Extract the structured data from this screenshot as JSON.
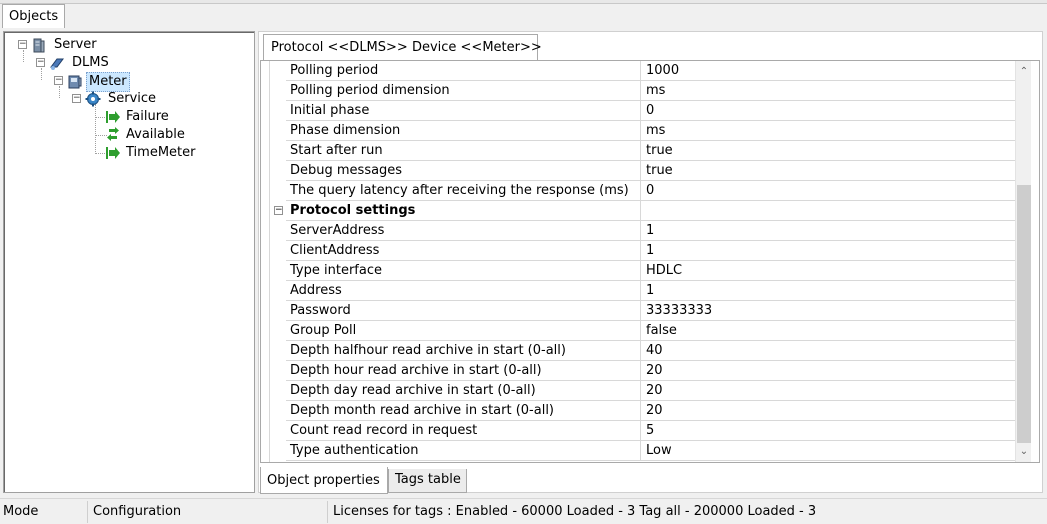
{
  "left_tab": {
    "label": "Objects"
  },
  "tree": {
    "server": "Server",
    "dlms": "DLMS",
    "meter": "Meter",
    "service": "Service",
    "failure": "Failure",
    "available": "Available",
    "timemeter": "TimeMeter"
  },
  "protocol_tab": {
    "label": "Protocol <<DLMS>> Device <<Meter>>"
  },
  "properties": [
    {
      "name": "Polling period",
      "value": "1000"
    },
    {
      "name": "Polling period dimension",
      "value": "ms"
    },
    {
      "name": "Initial phase",
      "value": "0"
    },
    {
      "name": "Phase dimension",
      "value": "ms"
    },
    {
      "name": "Start after run",
      "value": "true"
    },
    {
      "name": "Debug messages",
      "value": "true"
    },
    {
      "name": "The query latency after receiving the response (ms)",
      "value": "0"
    },
    {
      "name": "Protocol settings",
      "value": "",
      "category": true
    },
    {
      "name": "ServerAddress",
      "value": "1"
    },
    {
      "name": "ClientAddress",
      "value": "1"
    },
    {
      "name": "Type interface",
      "value": "HDLC"
    },
    {
      "name": "Address",
      "value": "1"
    },
    {
      "name": "Password",
      "value": "33333333"
    },
    {
      "name": "Group Poll",
      "value": "false"
    },
    {
      "name": "Depth halfhour read archive in start (0-all)",
      "value": "40"
    },
    {
      "name": "Depth hour read archive in start (0-all)",
      "value": "20"
    },
    {
      "name": "Depth day read archive in start (0-all)",
      "value": "20"
    },
    {
      "name": "Depth month read archive in start (0-all)",
      "value": "20"
    },
    {
      "name": "Count read record in request",
      "value": "5"
    },
    {
      "name": "Type authentication",
      "value": "Low"
    }
  ],
  "bottom_tabs": {
    "object_properties": "Object properties",
    "tags_table": "Tags table"
  },
  "statusbar": {
    "mode": "Mode",
    "configuration": "Configuration",
    "licenses": "Licenses for tags : Enabled - 60000  Loaded - 3 Tag all - 200000  Loaded - 3"
  },
  "colors": {
    "selection": "#cce8ff",
    "signal_arrow": "#2e9e2e",
    "service_icon": "#3a86c8"
  },
  "icons": {
    "server": "server-icon",
    "dlms": "protocol-icon",
    "meter": "meter-icon",
    "service": "service-icon",
    "signal": "green-arrow-icon"
  }
}
